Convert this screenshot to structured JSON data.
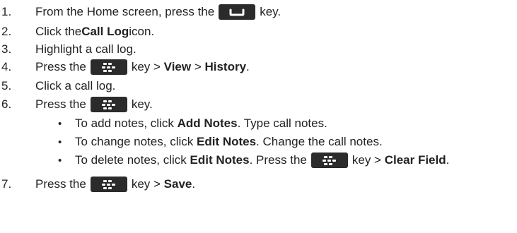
{
  "steps": [
    {
      "num": "1.",
      "pre": "From the Home screen, press the",
      "key": "send-key-icon",
      "post": "key."
    },
    {
      "num": "2.",
      "pre": "Click the ",
      "bold": "Call Log",
      "post": " icon."
    },
    {
      "num": "3.",
      "text": "Highlight a call log."
    },
    {
      "num": "4.",
      "pre": "Press the",
      "key": "menu-key-icon",
      "post": "key > ",
      "bold1": "View",
      "mid": " > ",
      "bold2": "History",
      "end": "."
    },
    {
      "num": "5.",
      "text": "Click a call log."
    },
    {
      "num": "6.",
      "pre": "Press the",
      "key": "menu-key-icon",
      "post": "key."
    },
    {
      "num": "7.",
      "pre": "Press the",
      "key": "menu-key-icon",
      "post": "key > ",
      "bold": "Save",
      "end": "."
    }
  ],
  "bullets": [
    {
      "pre": "To add notes, click ",
      "bold": "Add Notes",
      "post": ". Type call notes."
    },
    {
      "pre": "To change notes, click ",
      "bold": "Edit Notes",
      "post": ". Change the call notes."
    },
    {
      "pre": "To delete notes, click ",
      "bold": "Edit Notes",
      "post": ". Press the",
      "key": "menu-key-icon",
      "post2": "key > ",
      "bold2": "Clear Field",
      "end": "."
    }
  ],
  "bullet_char": "•"
}
